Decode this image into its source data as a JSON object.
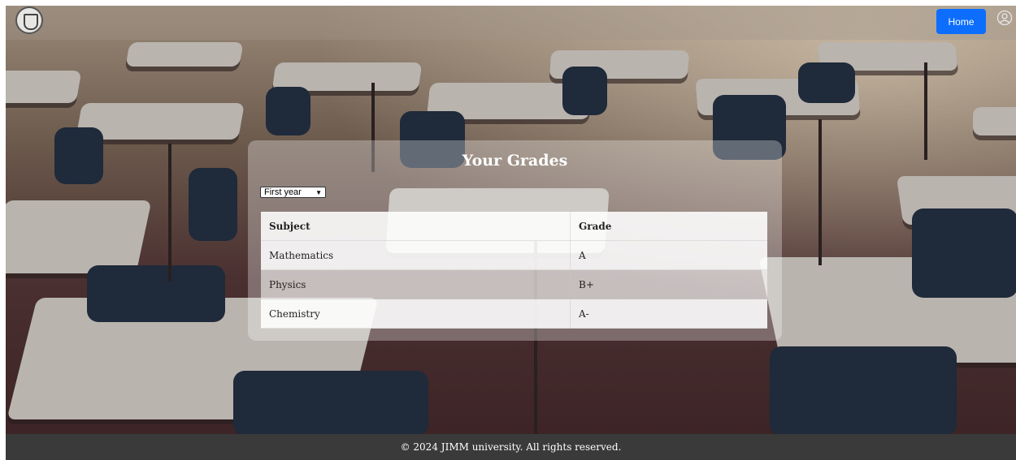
{
  "header": {
    "home_label": "Home"
  },
  "grades": {
    "title": "Your Grades",
    "year_selected": "First year",
    "columns": [
      "Subject",
      "Grade"
    ],
    "rows": [
      {
        "subject": "Mathematics",
        "grade": "A"
      },
      {
        "subject": "Physics",
        "grade": "B+"
      },
      {
        "subject": "Chemistry",
        "grade": "A-"
      }
    ]
  },
  "footer": {
    "text": "© 2024 JIMM university. All rights reserved."
  },
  "colors": {
    "accent": "#0d6efd",
    "footer_bg": "#3a3a3a"
  },
  "icons": {
    "logo": "university-seal-logo",
    "user": "user-circle-icon"
  }
}
